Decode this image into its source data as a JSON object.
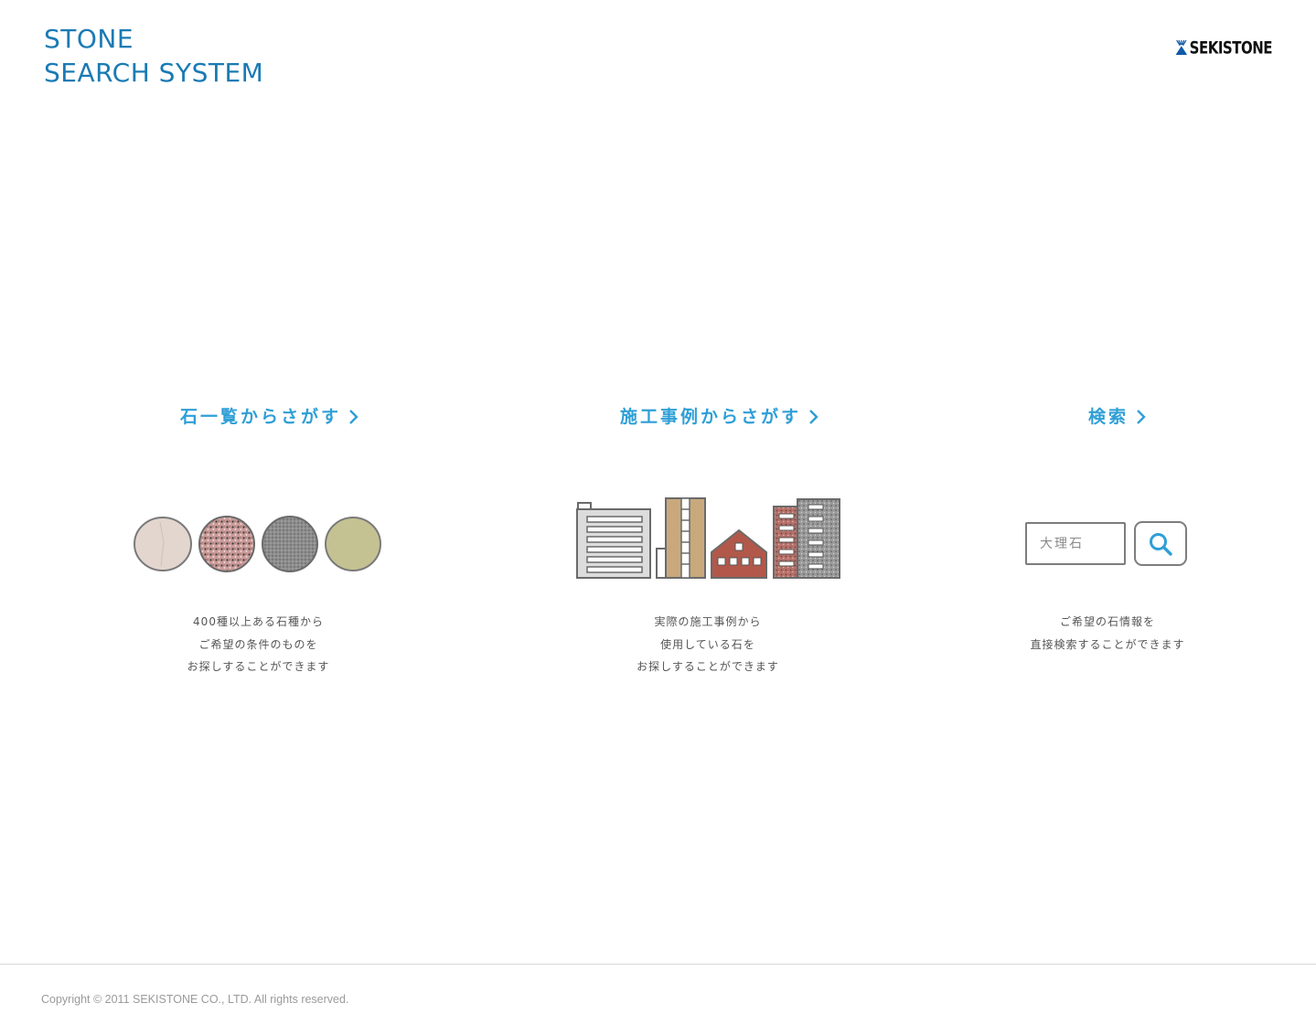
{
  "header": {
    "title_line1": "STONE",
    "title_line2": "SEARCH SYSTEM",
    "logo_text": "SEKISTONE",
    "brand_color": "#1a7ab4"
  },
  "features": [
    {
      "link_label": "石一覧からさがす",
      "icon": "stone-samples",
      "desc_lines": [
        "400種以上ある石種から",
        "ご希望の条件のものを",
        "お探しすることができます"
      ]
    },
    {
      "link_label": "施工事例からさがす",
      "icon": "buildings",
      "desc_lines": [
        "実際の施工事例から",
        "使用している石を",
        "お探しすることができます"
      ]
    },
    {
      "link_label": "検索",
      "icon": "search",
      "desc_lines": [
        "ご希望の石情報を",
        "直接検索することができます"
      ]
    }
  ],
  "search": {
    "placeholder": "大理石",
    "button_icon": "magnifier-icon"
  },
  "footer": {
    "copyright": "Copyright © 2011 SEKISTONE CO., LTD. All rights reserved."
  },
  "colors": {
    "link": "#2f9fd6",
    "title": "#1a7ab4",
    "text": "#555555",
    "footer_text": "#9a9a9a"
  }
}
